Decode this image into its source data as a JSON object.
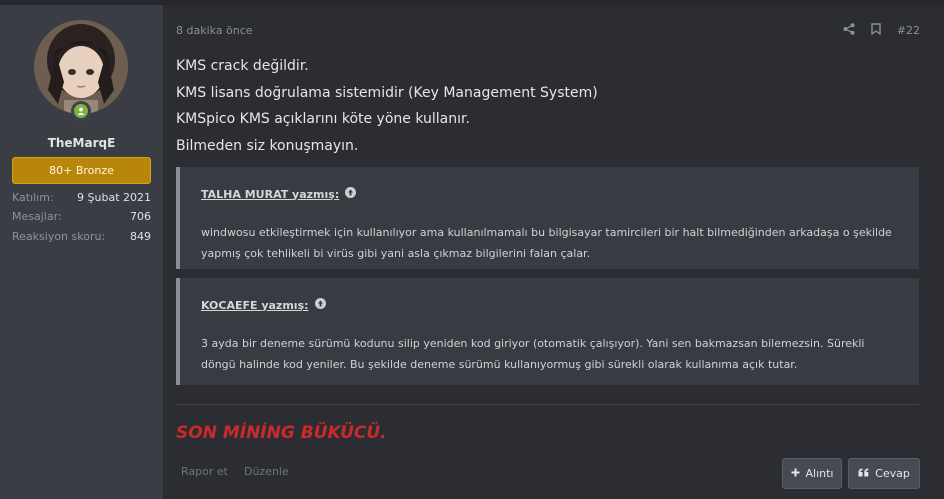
{
  "user": {
    "username": "TheMarqE",
    "rank": "80+ Bronze",
    "stats": [
      {
        "key": "Katılım:",
        "value": "9 Şubat 2021"
      },
      {
        "key": "Mesajlar:",
        "value": "706"
      },
      {
        "key": "Reaksiyon skoru:",
        "value": "849"
      }
    ],
    "online_color": "#7cb342"
  },
  "post": {
    "time": "8 dakika önce",
    "number": "#22",
    "lines": [
      "KMS crack değildir.",
      "KMS lisans doğrulama sistemidir (Key Management System)",
      "KMSpico KMS açıklarını köte yöne kullanır.",
      "Bilmeden siz konuşmayın."
    ],
    "quotes": [
      {
        "author": "TALHA MURAT yazmış:",
        "text": "windwosu etkileştirmek için kullanılıyor ama kullanılmamalı bu bilgisayar tamircileri bir halt bilmediğinden arkadaşa o şekilde yapmış çok tehlikeli bi virüs gibi yani asla çıkmaz bilgilerini falan çalar."
      },
      {
        "author": "KOCAEFE yazmış:",
        "text": "3 ayda bir deneme sürümü kodunu silip yeniden kod giriyor (otomatik çalışıyor). Yani sen bakmazsan bilemezsin. Sürekli döngü halinde kod yeniler. Bu şekilde deneme sürümü kullanıyormuş gibi sürekli olarak kullanıma açık tutar."
      }
    ],
    "signature": "SON MİNİNG BÜKÜCÜ.",
    "signature_color": "#c92a2a"
  },
  "footer": {
    "report": "Rapor et",
    "edit": "Düzenle",
    "quote_btn": "Alıntı",
    "reply_btn": "Cevap"
  },
  "icons": [
    "share-icon",
    "bookmark-icon",
    "arrow-up-circle-icon",
    "plus-icon",
    "quote-icon",
    "online-user-icon"
  ]
}
